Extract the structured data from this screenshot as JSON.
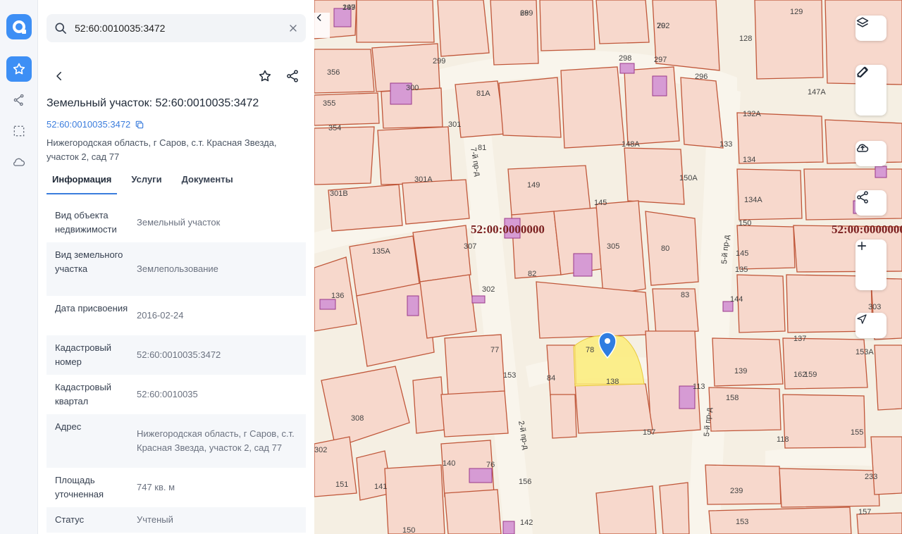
{
  "search": {
    "value": "52:60:0010035:3472",
    "placeholder": ""
  },
  "card": {
    "title": "Земельный участок: 52:60:0010035:3472",
    "cadastral_link": "52:60:0010035:3472",
    "address": "Нижегородская область, г Саров, с.т. Красная Звезда, участок 2, сад 77"
  },
  "tabs": [
    {
      "label": "Информация",
      "active": true
    },
    {
      "label": "Услуги",
      "active": false
    },
    {
      "label": "Документы",
      "active": false
    }
  ],
  "info_rows": [
    {
      "key": "Вид объекта недвижимости",
      "value": "Земельный участок"
    },
    {
      "key": "Вид земельного участка",
      "value": "Землепользование"
    },
    {
      "key": "Дата присвоения",
      "value": "2016-02-24"
    },
    {
      "key": "Кадастровый номер",
      "value": "52:60:0010035:3472"
    },
    {
      "key": "Кадастровый квартал",
      "value": "52:60:0010035"
    },
    {
      "key": "Адрес",
      "value": "Нижегородская область, г Саров, с.т. Красная Звезда, участок 2, сад 77"
    },
    {
      "key": "Площадь уточненная",
      "value": "747 кв. м"
    },
    {
      "key": "Статус",
      "value": "Учтеный"
    }
  ],
  "map": {
    "quarter_labels": [
      "52:00:0000000",
      "52:00:0000000"
    ],
    "street_labels": [
      "7-й пр-д",
      "2-й пр-д",
      "5-й пр-д",
      "5-й пр-д"
    ],
    "parcel_numbers": [
      "297",
      "289",
      "292",
      "129",
      "128",
      "356",
      "299",
      "298",
      "297",
      "296",
      "355",
      "300",
      "81А",
      "147А",
      "354",
      "301",
      "81",
      "148А",
      "133",
      "132А",
      "134",
      "301А",
      "301В",
      "149",
      "150А",
      "145",
      "134А",
      "150",
      "135А",
      "307",
      "305",
      "80",
      "145",
      "135",
      "136",
      "308",
      "302",
      "82",
      "83",
      "144",
      "137",
      "303",
      "153А",
      "77",
      "78",
      "138",
      "162",
      "159",
      "153",
      "84",
      "113",
      "139",
      "158",
      "157",
      "302",
      "140",
      "76",
      "118",
      "155",
      "151",
      "141",
      "156",
      "239",
      "233",
      "150",
      "142",
      "153",
      "157",
      "149",
      "69",
      "70"
    ],
    "colors": {
      "parcel_fill": "#f7d8cc",
      "parcel_stroke": "#c0573a",
      "building": "#d69bd4",
      "selected": "#fbec7a",
      "quarter_text": "#7a1f1f"
    }
  },
  "icons": {
    "rail": [
      "logo-icon",
      "star-icon",
      "route-icon",
      "selection-icon",
      "cloud-icon"
    ],
    "controls": [
      "layers-icon",
      "ruler-icon",
      "edit-icon",
      "upload-icon",
      "share-icon",
      "zoom-in-icon",
      "zoom-out-icon",
      "locate-icon"
    ]
  }
}
